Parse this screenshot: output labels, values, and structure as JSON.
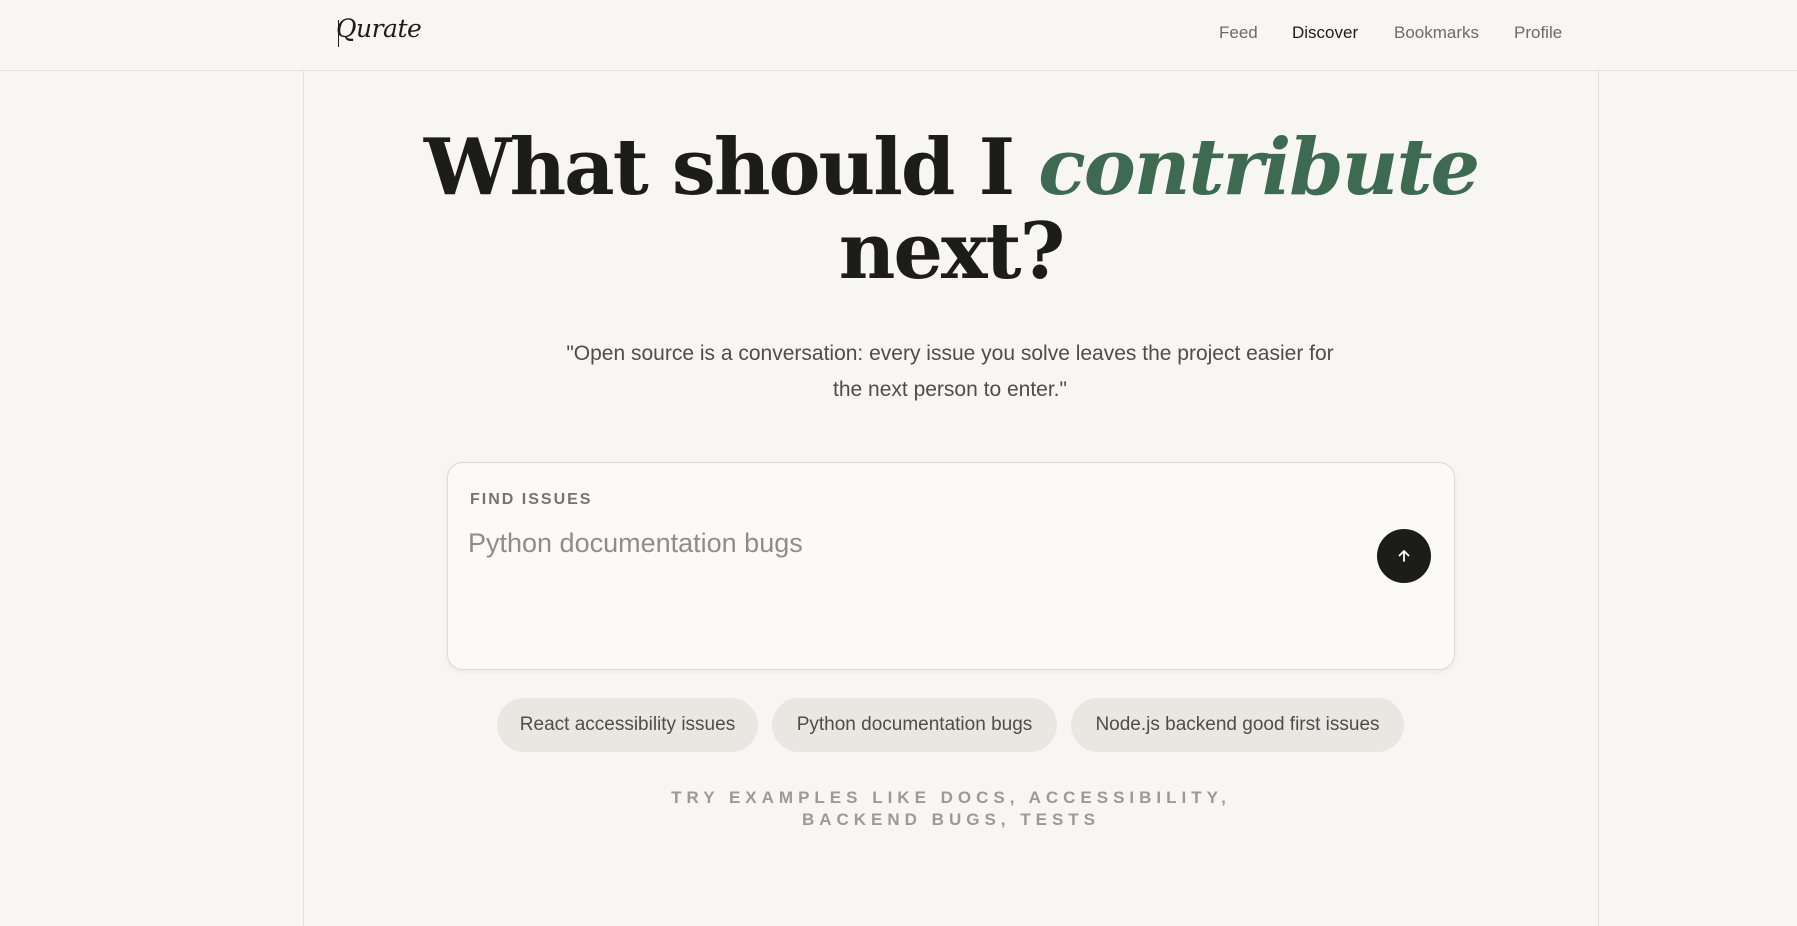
{
  "app": {
    "logo": "Qurate"
  },
  "nav": {
    "items": [
      {
        "label": "Feed",
        "active": false
      },
      {
        "label": "Discover",
        "active": true
      },
      {
        "label": "Bookmarks",
        "active": false
      },
      {
        "label": "Profile",
        "active": false
      }
    ]
  },
  "hero": {
    "headline_part1": "What should I ",
    "headline_accent": "contribute",
    "headline_part2": "next?",
    "quote": "\"Open source is a conversation: every issue you solve leaves the project easier for the next person to enter.\""
  },
  "search": {
    "label": "FIND ISSUES",
    "placeholder": "Python documentation bugs",
    "value": "",
    "submit_icon": "arrow-up-icon"
  },
  "suggestions": [
    "React accessibility issues",
    "Python documentation bugs",
    "Node.js backend good first issues"
  ],
  "hint": "TRY EXAMPLES LIKE DOCS, ACCESSIBILITY, BACKEND BUGS, TESTS",
  "colors": {
    "background": "#f7f6f2",
    "accent": "#3f6a52",
    "text": "#1c1c1a",
    "chip_bg": "#e9e7e2",
    "button_bg": "#1c1c1a"
  }
}
